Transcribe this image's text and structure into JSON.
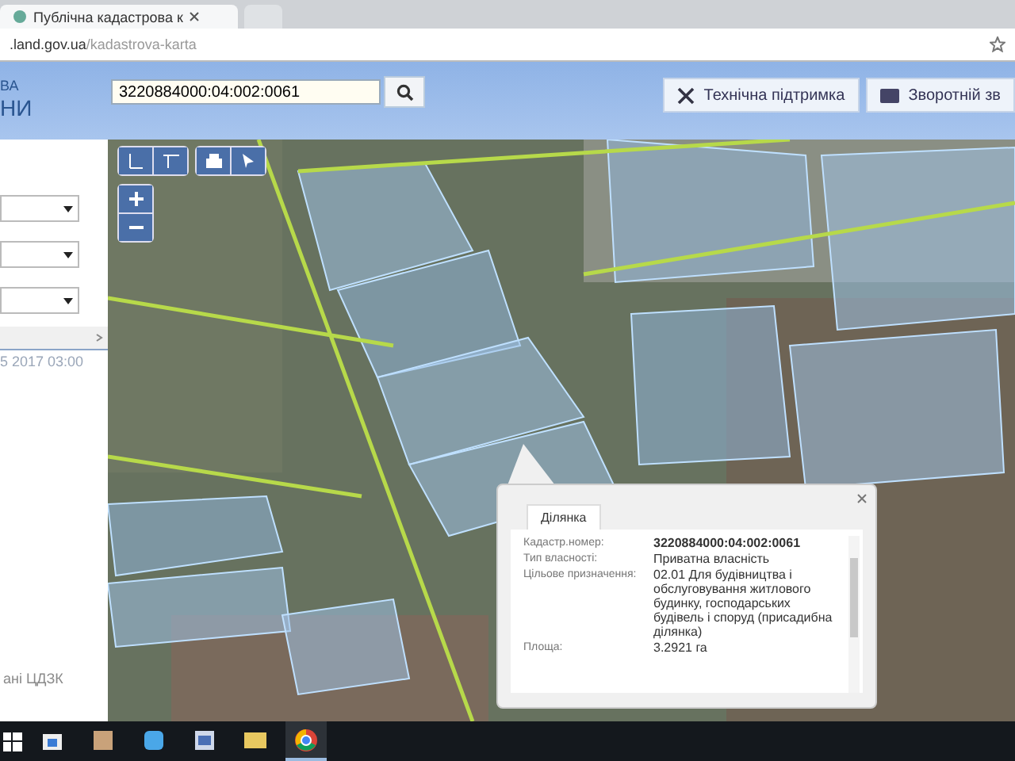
{
  "browser": {
    "tabs": [
      {
        "label": "Публічна кадастрова к",
        "selected": true
      },
      {
        "selected": false
      }
    ],
    "url_host": ".land.gov.ua",
    "url_path": "/kadastrova-karta"
  },
  "header": {
    "logo_lines": [
      "ВА",
      "НИ"
    ],
    "search": {
      "value": "3220884000:04:002:0061"
    },
    "buttons": [
      {
        "kind": "support",
        "label": "Технічна підтримка"
      },
      {
        "kind": "feedback",
        "label": "Зворотній зв"
      }
    ]
  },
  "sidebar": {
    "date": "5 2017 03:00",
    "footer": "ані ЦДЗК"
  },
  "popup": {
    "tab": "Ділянка",
    "rows": [
      {
        "label": "Кадастр.номер:",
        "value": "3220884000:04:002:0061",
        "bold": true
      },
      {
        "label": "Тип власності:",
        "value": "Приватна власність",
        "bold": false
      },
      {
        "label": "Цільове призначення:",
        "value": "02.01 Для будівництва і обслуговування житлового будинку, господарських будівель і споруд (присадибна ділянка)",
        "bold": false
      },
      {
        "label": "Площа:",
        "value": "3.2921 га",
        "bold": false
      }
    ]
  },
  "taskbar": {
    "apps": [
      {
        "kind": "store",
        "selected": false
      },
      {
        "kind": "media",
        "selected": false
      },
      {
        "kind": "skype",
        "selected": false
      },
      {
        "kind": "word",
        "selected": false
      },
      {
        "kind": "folder",
        "selected": false
      },
      {
        "kind": "chrome",
        "selected": true
      }
    ]
  }
}
